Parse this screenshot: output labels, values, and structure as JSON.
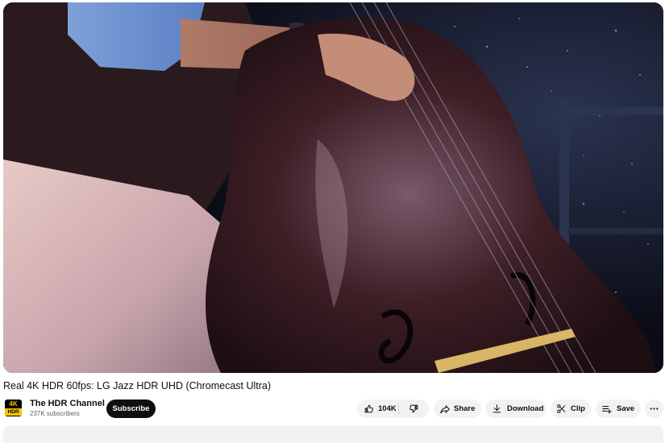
{
  "video": {
    "title": "Real 4K HDR 60fps: LG Jazz HDR UHD (Chromecast Ultra)"
  },
  "channel": {
    "logo_top": "4K",
    "logo_bottom": "HDR",
    "name": "The HDR Channel",
    "subscribers": "237K subscribers"
  },
  "actions": {
    "subscribe_label": "Subscribe",
    "like_count": "104K",
    "share_label": "Share",
    "download_label": "Download",
    "clip_label": "Clip",
    "save_label": "Save"
  },
  "icons": {
    "like": "thumb-up-icon",
    "dislike": "thumb-down-icon",
    "share": "share-icon",
    "download": "download-icon",
    "clip": "scissors-icon",
    "save": "playlist-add-icon",
    "more": "more-horizontal-icon"
  },
  "colors": {
    "subscribe_bg": "#0f0f0f",
    "pill_bg": "#f2f2f2",
    "logo_yellow": "#f5c700"
  }
}
